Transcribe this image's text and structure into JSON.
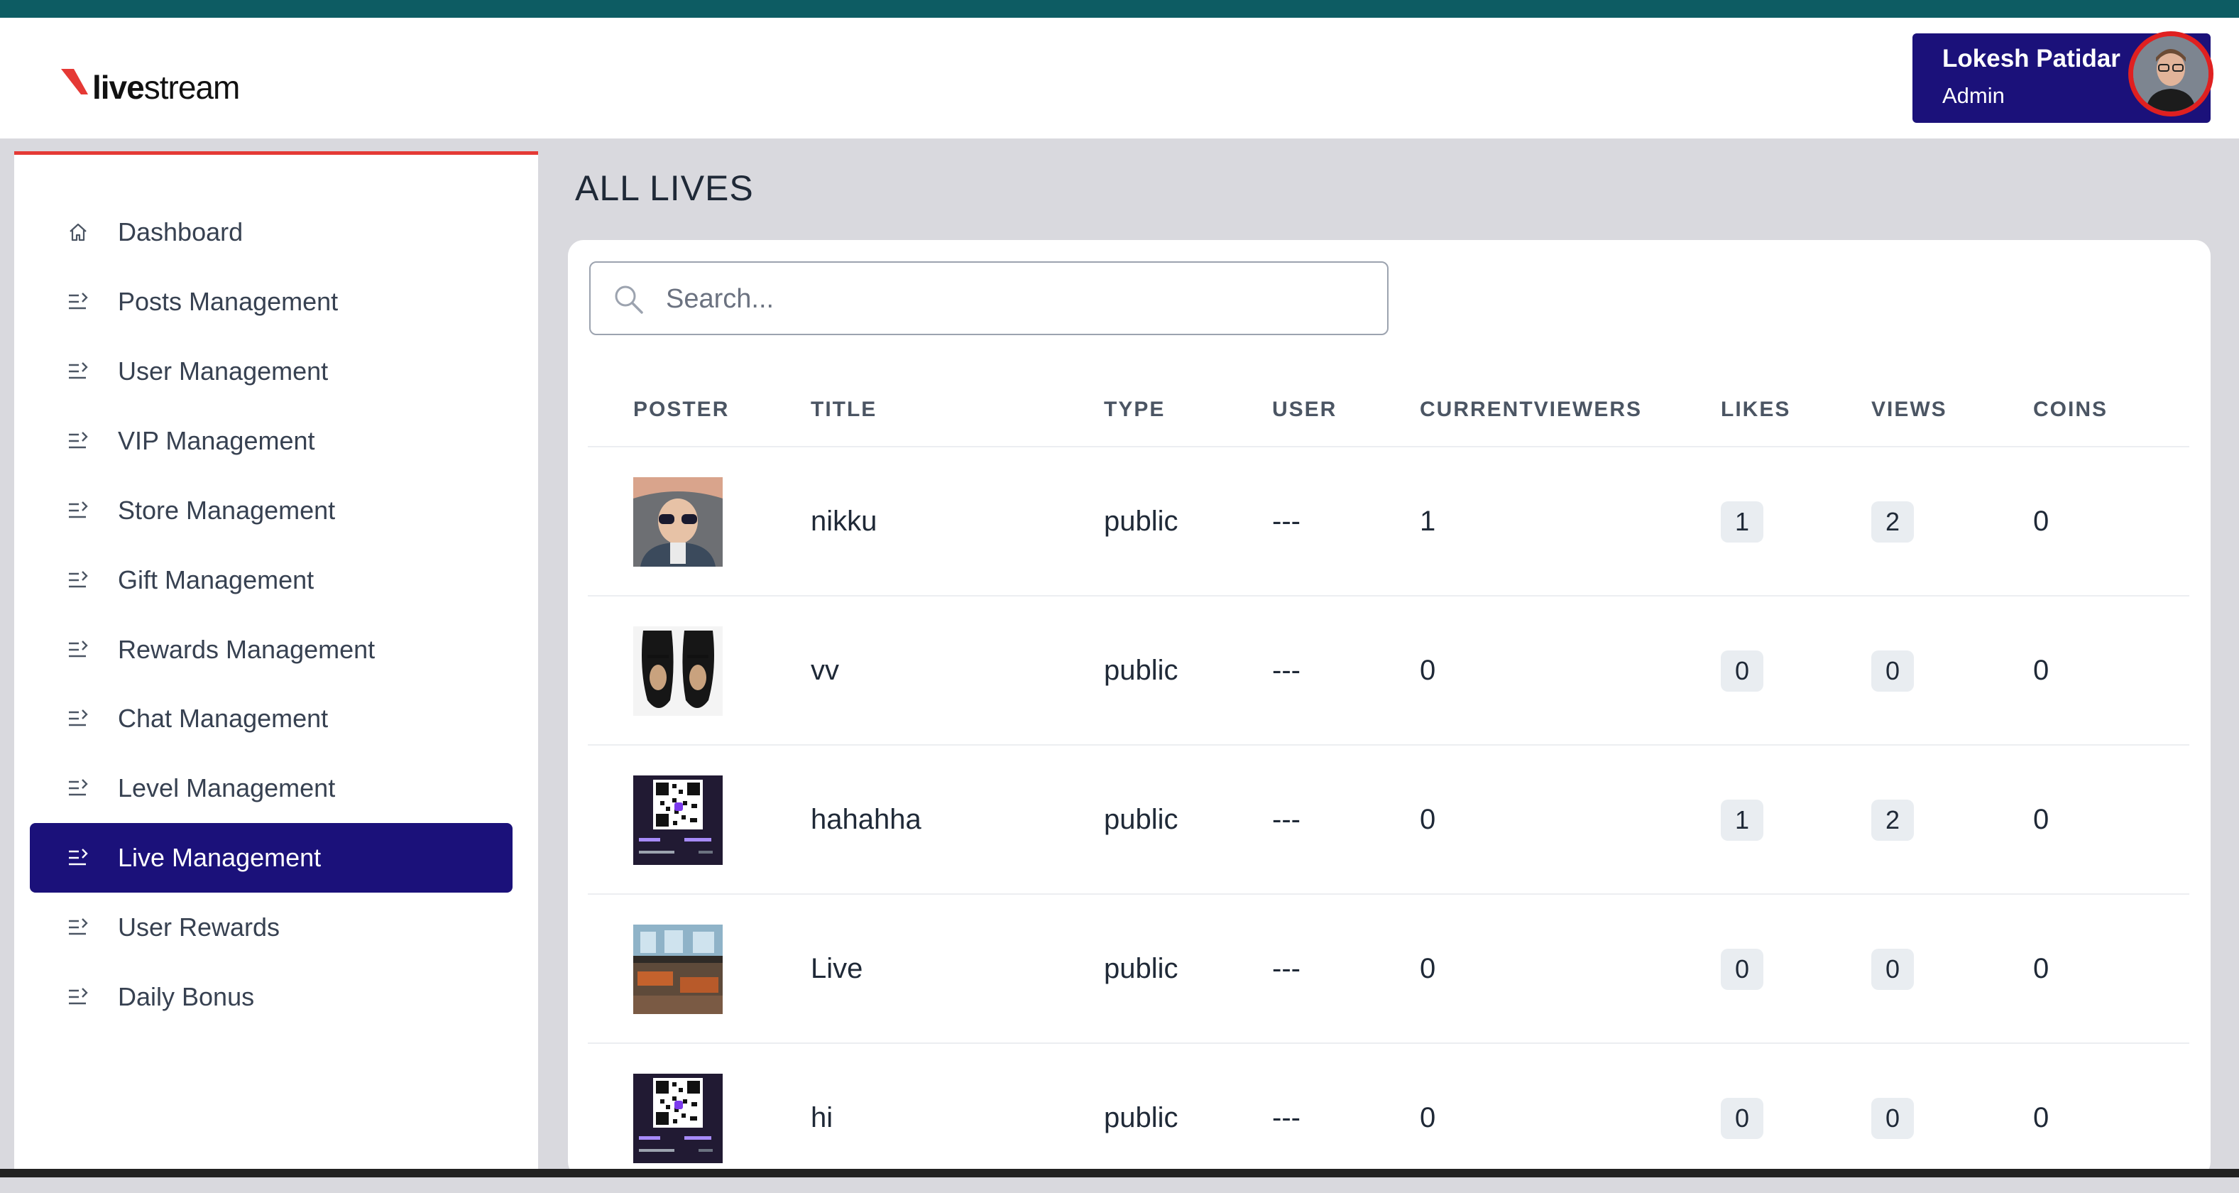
{
  "app": {
    "logo_text_bold": "live",
    "logo_text_rest": "stream",
    "brand_color": "#e53935",
    "accent_color": "#1b117a"
  },
  "user": {
    "name": "Lokesh Patidar",
    "role": "Admin"
  },
  "sidebar": {
    "items": [
      {
        "label": "Dashboard",
        "icon": "home-icon",
        "active": false
      },
      {
        "label": "Posts Management",
        "icon": "list-arrow-icon",
        "active": false
      },
      {
        "label": "User Management",
        "icon": "list-arrow-icon",
        "active": false
      },
      {
        "label": "VIP Management",
        "icon": "list-arrow-icon",
        "active": false
      },
      {
        "label": "Store Management",
        "icon": "list-arrow-icon",
        "active": false
      },
      {
        "label": "Gift Management",
        "icon": "list-arrow-icon",
        "active": false
      },
      {
        "label": "Rewards Management",
        "icon": "list-arrow-icon",
        "active": false
      },
      {
        "label": "Chat Management",
        "icon": "list-arrow-icon",
        "active": false
      },
      {
        "label": "Level Management",
        "icon": "list-arrow-icon",
        "active": false
      },
      {
        "label": "Live Management",
        "icon": "list-arrow-icon",
        "active": true
      },
      {
        "label": "User Rewards",
        "icon": "list-arrow-icon",
        "active": false
      },
      {
        "label": "Daily Bonus",
        "icon": "list-arrow-icon",
        "active": false
      }
    ]
  },
  "main": {
    "title": "ALL LIVES",
    "search": {
      "placeholder": "Search...",
      "value": ""
    },
    "table": {
      "columns": [
        "POSTER",
        "TITLE",
        "TYPE",
        "USER",
        "CURRENTVIEWERS",
        "LIKES",
        "VIEWS",
        "COINS"
      ],
      "rows": [
        {
          "poster": "child-with-sunglasses-image",
          "title": "nikku",
          "type": "public",
          "user": "---",
          "current_viewers": "1",
          "likes": "1",
          "views": "2",
          "coins": "0"
        },
        {
          "poster": "black-shoes-image",
          "title": "vv",
          "type": "public",
          "user": "---",
          "current_viewers": "0",
          "likes": "0",
          "views": "0",
          "coins": "0"
        },
        {
          "poster": "qr-code-image",
          "title": "hahahha",
          "type": "public",
          "user": "---",
          "current_viewers": "0",
          "likes": "1",
          "views": "2",
          "coins": "0"
        },
        {
          "poster": "restaurant-interior-image",
          "title": "Live",
          "type": "public",
          "user": "---",
          "current_viewers": "0",
          "likes": "0",
          "views": "0",
          "coins": "0"
        },
        {
          "poster": "qr-code-image",
          "title": "hi",
          "type": "public",
          "user": "---",
          "current_viewers": "0",
          "likes": "0",
          "views": "0",
          "coins": "0"
        }
      ]
    }
  }
}
